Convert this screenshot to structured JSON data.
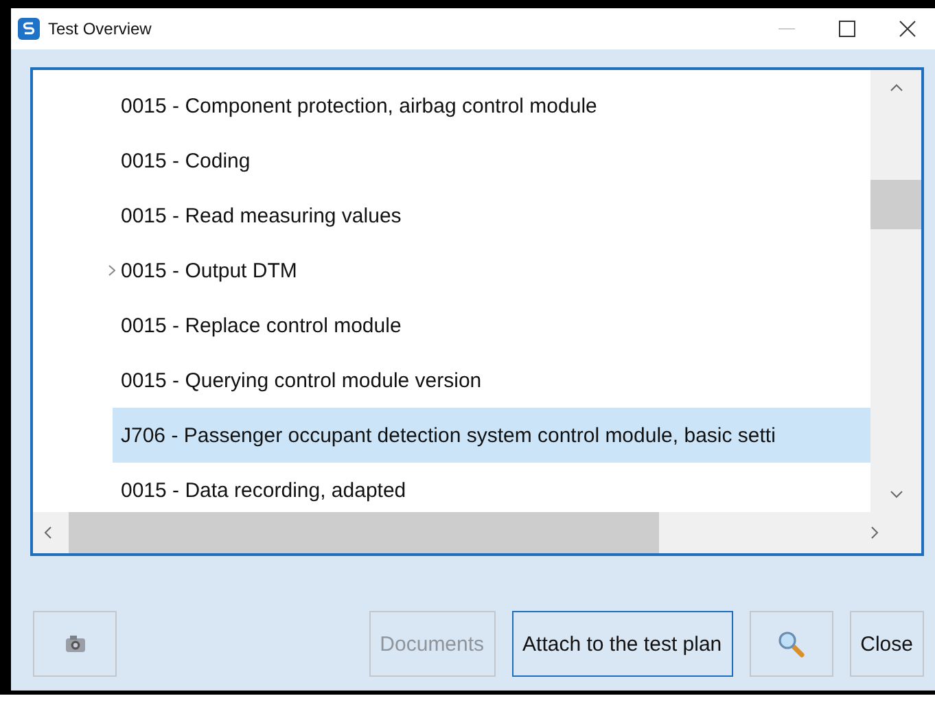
{
  "window": {
    "title": "Test Overview"
  },
  "tests": [
    {
      "label": "0015 - Component protection, airbag control module",
      "expandable": false,
      "selected": false
    },
    {
      "label": "0015 - Coding",
      "expandable": false,
      "selected": false
    },
    {
      "label": "0015 - Read measuring values",
      "expandable": false,
      "selected": false
    },
    {
      "label": "0015 - Output DTM",
      "expandable": true,
      "selected": false
    },
    {
      "label": "0015 - Replace control module",
      "expandable": false,
      "selected": false
    },
    {
      "label": "0015 - Querying control module version",
      "expandable": false,
      "selected": false
    },
    {
      "label": "J706 - Passenger occupant detection system control module, basic setti",
      "expandable": false,
      "selected": true
    },
    {
      "label": "0015 -  Data recording, adapted",
      "expandable": false,
      "selected": false
    }
  ],
  "buttons": [
    {
      "kind": "camera",
      "disabled": false,
      "focused": false
    },
    {
      "kind": "text",
      "label": "Documents",
      "disabled": true,
      "focused": false
    },
    {
      "kind": "text",
      "label": "Attach to the test plan",
      "disabled": false,
      "focused": true
    },
    {
      "kind": "search",
      "disabled": false,
      "focused": false
    },
    {
      "kind": "text",
      "label": "Close",
      "disabled": false,
      "focused": false
    }
  ]
}
